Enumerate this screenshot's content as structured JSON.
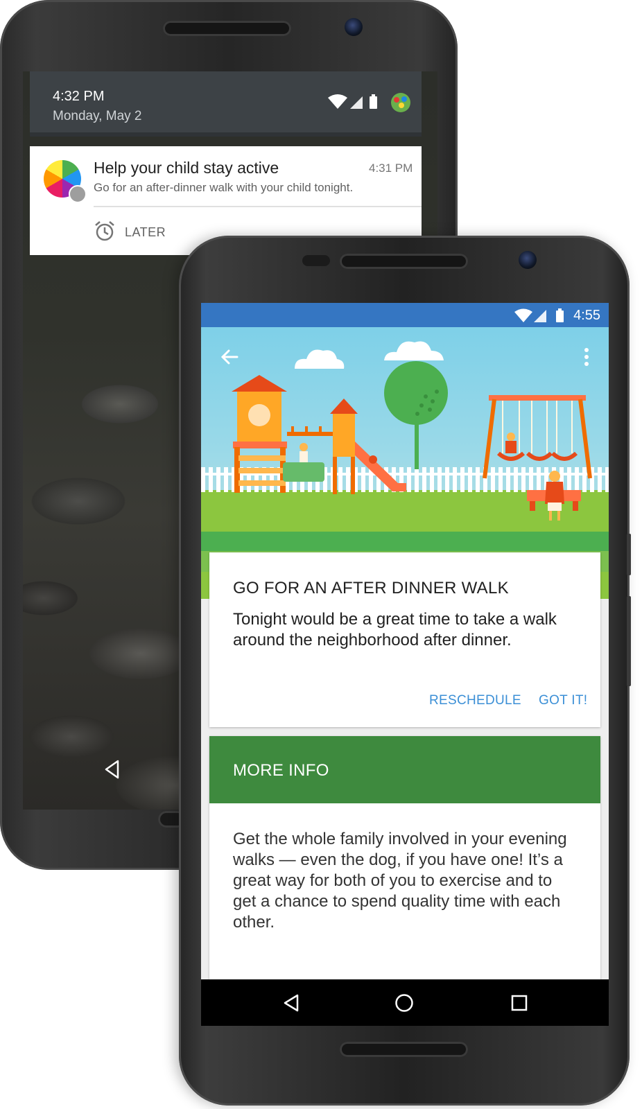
{
  "back_phone": {
    "status": {
      "time": "4:32 PM",
      "date": "Monday, May 2"
    },
    "notification": {
      "title": "Help your child stay active",
      "time": "4:31 PM",
      "text": "Go for an after-dinner walk with your child tonight.",
      "action_label": "LATER",
      "action_icon": "alarm-clock-icon"
    }
  },
  "front_phone": {
    "status": {
      "time": "4:55"
    },
    "hero_icons": {
      "back": "arrow-left-icon",
      "menu": "more-vert-icon"
    },
    "card": {
      "title": "GO FOR AN AFTER DINNER WALK",
      "body": "Tonight would be a great time to take a walk around the neighborhood after dinner.",
      "secondary_action": "RESCHEDULE",
      "primary_action": "GOT IT!"
    },
    "more_info": {
      "title": "MORE INFO",
      "body": "Get the whole family involved in your evening walks — even the dog, if you have one! It’s a great way for both of you to exercise and to get a chance to spend quality time with each other."
    }
  },
  "colors": {
    "status_bar": "#3576c2",
    "more_info_header": "#3e8a3e",
    "action_text": "#3b8fd6"
  }
}
